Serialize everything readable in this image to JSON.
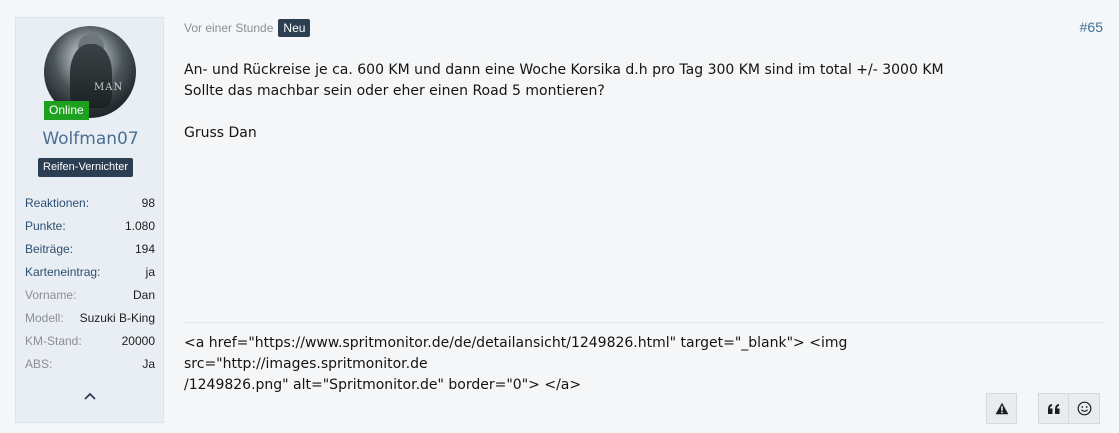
{
  "author": {
    "online_label": "Online",
    "avatar_text": "MAN",
    "username": "Wolfman07",
    "title": "Reifen-Vernichter",
    "stats": [
      {
        "label": "Reaktionen:",
        "value": "98",
        "link": true
      },
      {
        "label": "Punkte:",
        "value": "1.080",
        "link": true
      },
      {
        "label": "Beiträge:",
        "value": "194",
        "link": true
      },
      {
        "label": "Karteneintrag:",
        "value": "ja",
        "link": true
      },
      {
        "label": "Vorname:",
        "value": "Dan",
        "link": false
      },
      {
        "label": "Modell:",
        "value": "Suzuki B-King",
        "link": false
      },
      {
        "label": "KM-Stand:",
        "value": "20000",
        "link": false
      },
      {
        "label": "ABS:",
        "value": "Ja",
        "link": false
      }
    ]
  },
  "post": {
    "time": "Vor einer Stunde",
    "new_badge": "Neu",
    "number": "#65",
    "lines": [
      "An- und Rückreise je ca. 600 KM und dann eine Woche Korsika d.h pro Tag 300 KM sind im total +/- 3000 KM",
      "Sollte das machbar sein oder eher einen Road 5 montieren?",
      "",
      "Gruss Dan"
    ],
    "signature_line1": "<a href=\"https://www.spritmonitor.de/de/detailansicht/1249826.html\" target=\"_blank\"> <img src=\"http://images.spritmonitor.de",
    "signature_line2": "/1249826.png\" alt=\"Spritmonitor.de\" border=\"0\"> </a>"
  },
  "icons": {
    "report": "warning-icon",
    "quote": "quote-icon",
    "react": "smiley-icon",
    "collapse": "chevron-up-icon"
  },
  "colors": {
    "online": "#1ea11e",
    "username": "#4a6f93",
    "badge_bg": "#2c3e52",
    "link": "#2c4f71"
  }
}
